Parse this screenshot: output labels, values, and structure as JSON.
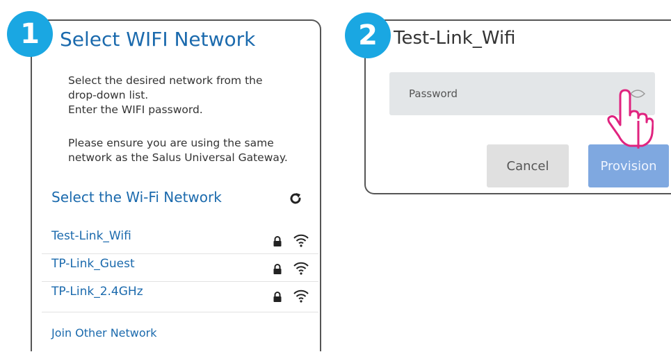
{
  "step1": {
    "badge": "1",
    "title": "Select WIFI Network",
    "instructions_a": [
      "Select the desired network from the",
      "drop-down list.",
      "Enter the WIFI password."
    ],
    "instructions_b": [
      "Please ensure you are using the same",
      "network as the Salus Universal Gateway."
    ],
    "list_heading": "Select the Wi-Fi Network",
    "networks": [
      {
        "name": "Test-Link_Wifi",
        "icons": [
          "lock-icon",
          "wifi-icon"
        ]
      },
      {
        "name": "TP-Link_Guest",
        "icons": [
          "lock-icon",
          "wifi-icon"
        ]
      },
      {
        "name": "TP-Link_2.4GHz",
        "icons": [
          "lock-icon",
          "wifi-icon"
        ]
      }
    ],
    "join_other": "Join Other Network"
  },
  "step2": {
    "badge": "2",
    "title": "Test-Link_Wifi",
    "password_placeholder": "Password",
    "cancel_label": "Cancel",
    "provision_label": "Provision"
  },
  "colors": {
    "accent_blue": "#1b6aad",
    "badge_blue": "#1aa7e2",
    "provision_button": "#7fa8e0",
    "pointer_hand": "#e0237f"
  }
}
